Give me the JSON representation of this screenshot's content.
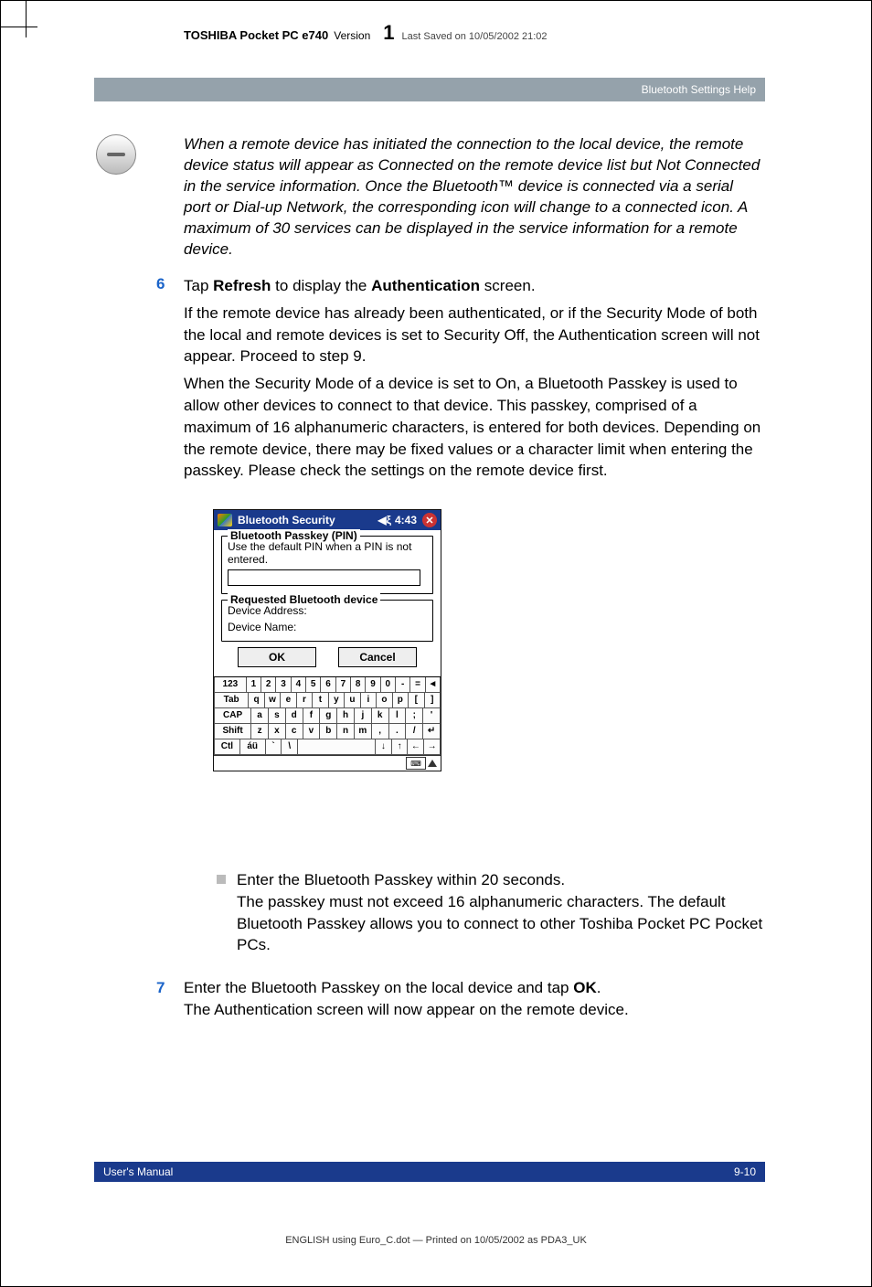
{
  "header": {
    "product": "TOSHIBA Pocket PC e740",
    "version_label": "Version",
    "version_num": "1",
    "saved": "Last Saved on 10/05/2002 21:02"
  },
  "section_bar": "Bluetooth Settings Help",
  "italic_note": "When a remote device has initiated the connection to the local device, the remote device status will appear as Connected on the remote device list but Not Connected in the service information. Once the Bluetooth™ device is connected via a serial port or Dial-up Network, the corresponding icon will change to a connected icon. A maximum of 30 services can be displayed in the service information for a remote device.",
  "step6": {
    "num": "6",
    "line_pre": "Tap ",
    "refresh": "Refresh",
    "line_mid": " to display the ",
    "auth": "Authentication",
    "line_post": " screen.",
    "para1": "If the remote device has already been authenticated, or if the Security Mode of both the local and remote devices is set to Security Off, the Authentication screen will not appear. Proceed to step 9.",
    "para2": "When the Security Mode of a device is set to On, a Bluetooth Passkey is used to allow other devices to connect to that device. This passkey, comprised of a maximum of 16 alphanumeric characters, is entered for both devices. Depending on the remote device, there may be fixed values or a character limit when entering the passkey. Please check the settings on the remote device first."
  },
  "screenshot": {
    "title": "Bluetooth Security",
    "sound_glyph": "◀ξ",
    "time": "4:43",
    "close": "✕",
    "pin_legend": "Bluetooth Passkey (PIN)",
    "pin_hint": "Use the default PIN when a PIN is not entered.",
    "req_legend": "Requested Bluetooth device",
    "dev_addr": "Device Address:",
    "dev_name": "Device Name:",
    "ok": "OK",
    "cancel": "Cancel",
    "kbd": {
      "r1": [
        "123",
        "1",
        "2",
        "3",
        "4",
        "5",
        "6",
        "7",
        "8",
        "9",
        "0",
        "-",
        "=",
        "◄"
      ],
      "r2": [
        "Tab",
        "q",
        "w",
        "e",
        "r",
        "t",
        "y",
        "u",
        "i",
        "o",
        "p",
        "[",
        "]"
      ],
      "r3": [
        "CAP",
        "a",
        "s",
        "d",
        "f",
        "g",
        "h",
        "j",
        "k",
        "l",
        ";",
        "'"
      ],
      "r4": [
        "Shift",
        "z",
        "x",
        "c",
        "v",
        "b",
        "n",
        "m",
        ",",
        ".",
        "/",
        "↵"
      ],
      "r5": [
        "Ctl",
        "áü",
        "`",
        "\\",
        "",
        "↓",
        "↑",
        "←",
        "→"
      ]
    }
  },
  "bullet": {
    "line1": "Enter the Bluetooth Passkey within 20 seconds.",
    "line2": "The passkey must not exceed 16 alphanumeric characters. The default Bluetooth Passkey allows you to connect to other Toshiba Pocket PC Pocket PCs."
  },
  "step7": {
    "num": "7",
    "line_pre": "Enter the Bluetooth Passkey on the local device and tap ",
    "ok": "OK",
    "line_post": ".",
    "para": "The Authentication screen will now appear on the remote device."
  },
  "footer": {
    "left": "User's Manual",
    "right": "9-10"
  },
  "print_footer": "ENGLISH using  Euro_C.dot — Printed on 10/05/2002 as PDA3_UK"
}
